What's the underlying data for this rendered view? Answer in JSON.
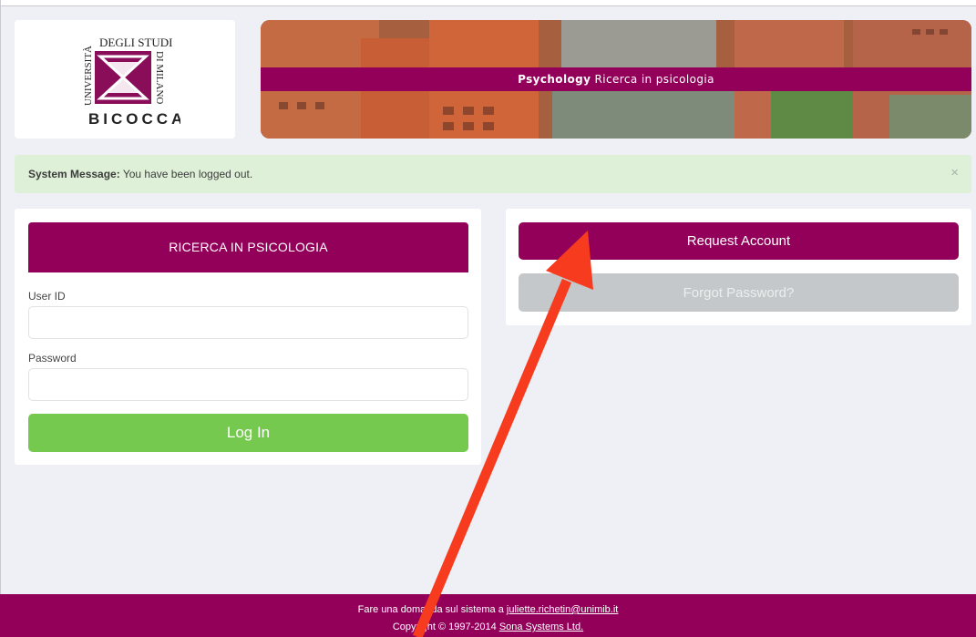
{
  "header": {
    "logo": {
      "text_top": "DEGLI STUDI",
      "text_left": "UNIVERSITÀ",
      "text_right": "DI MILANO",
      "text_bottom": "BICOCCA"
    },
    "banner": {
      "bold": "Psychology",
      "rest": "Ricerca in psicologia"
    }
  },
  "system_message": {
    "label": "System Message:",
    "text": "You have been logged out.",
    "close": "×"
  },
  "login": {
    "title": "RICERCA IN PSICOLOGIA",
    "user_label": "User ID",
    "user_value": "",
    "password_label": "Password",
    "password_value": "",
    "login_button": "Log In"
  },
  "account": {
    "request_button": "Request Account",
    "forgot_button": "Forgot Password?"
  },
  "footer": {
    "line1_prefix": "Fare una domanda sul sistema a",
    "email": "juliette.richetin@unimib.it",
    "line2_prefix": "Copyright © 1997-2014",
    "company": "Sona Systems Ltd."
  },
  "colors": {
    "brand": "#93005a",
    "success": "#75c94f",
    "message_bg": "#dff0d8",
    "disabled": "#c5c8ca",
    "annotation_arrow": "#f73b1e"
  },
  "icons": {
    "close": "close-icon",
    "annotation": "arrow-annotation"
  }
}
